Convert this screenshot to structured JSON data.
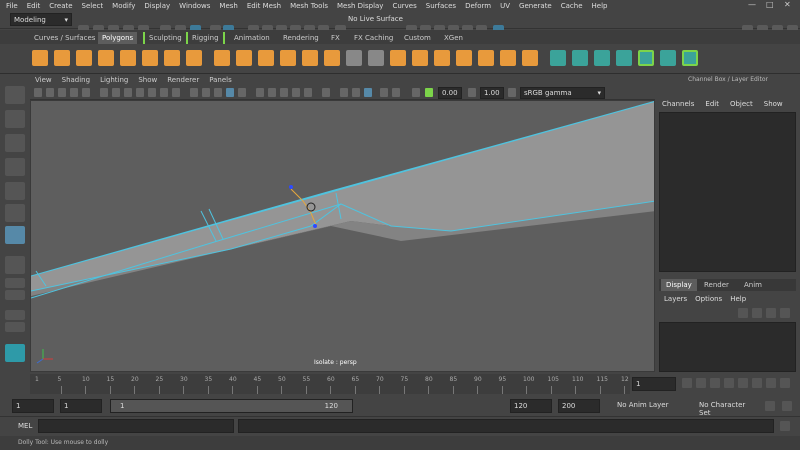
{
  "menubar": [
    "File",
    "Edit",
    "Create",
    "Select",
    "Modify",
    "Display",
    "Windows",
    "Mesh",
    "Edit Mesh",
    "Mesh Tools",
    "Mesh Display",
    "Curves",
    "Surfaces",
    "Deform",
    "UV",
    "Generate",
    "Cache",
    "Help"
  ],
  "status": {
    "mode": "Modeling",
    "live_surface": "No Live Surface"
  },
  "shelf_tabs": [
    "Curves / Surfaces",
    "Polygons",
    "Sculpting",
    "Rigging",
    "Animation",
    "Rendering",
    "FX",
    "FX Caching",
    "Custom",
    "XGen"
  ],
  "shelf_active": "Polygons",
  "panel_menu": [
    "View",
    "Shading",
    "Lighting",
    "Show",
    "Renderer",
    "Panels"
  ],
  "panel_toolbar": {
    "value_a": "0.00",
    "value_b": "1.00",
    "color_space": "sRGB gamma"
  },
  "viewport": {
    "label": "Isolate : persp"
  },
  "channel_box": {
    "title": "Channel Box / Layer Editor",
    "menu": [
      "Channels",
      "Edit",
      "Object",
      "Show"
    ]
  },
  "layer_editor": {
    "tabs": [
      "Display",
      "Render",
      "Anim"
    ],
    "active": "Display",
    "menu": [
      "Layers",
      "Options",
      "Help"
    ]
  },
  "timeline": {
    "ticks": [
      "5",
      "10",
      "15",
      "20",
      "25",
      "30",
      "35",
      "40",
      "45",
      "50",
      "55",
      "60",
      "65",
      "70",
      "75",
      "80",
      "85",
      "90",
      "95",
      "100",
      "105",
      "110",
      "115",
      "12"
    ],
    "first": "1",
    "current_frame": "1"
  },
  "range": {
    "start": "1",
    "anim_start": "1",
    "slider_start": "1",
    "slider_end": "120",
    "end": "120",
    "anim_end": "200",
    "anim_layer": "No Anim Layer",
    "char_set": "No Character Set"
  },
  "mel": {
    "label": "MEL"
  },
  "help_line": "Dolly Tool: Use mouse to dolly"
}
